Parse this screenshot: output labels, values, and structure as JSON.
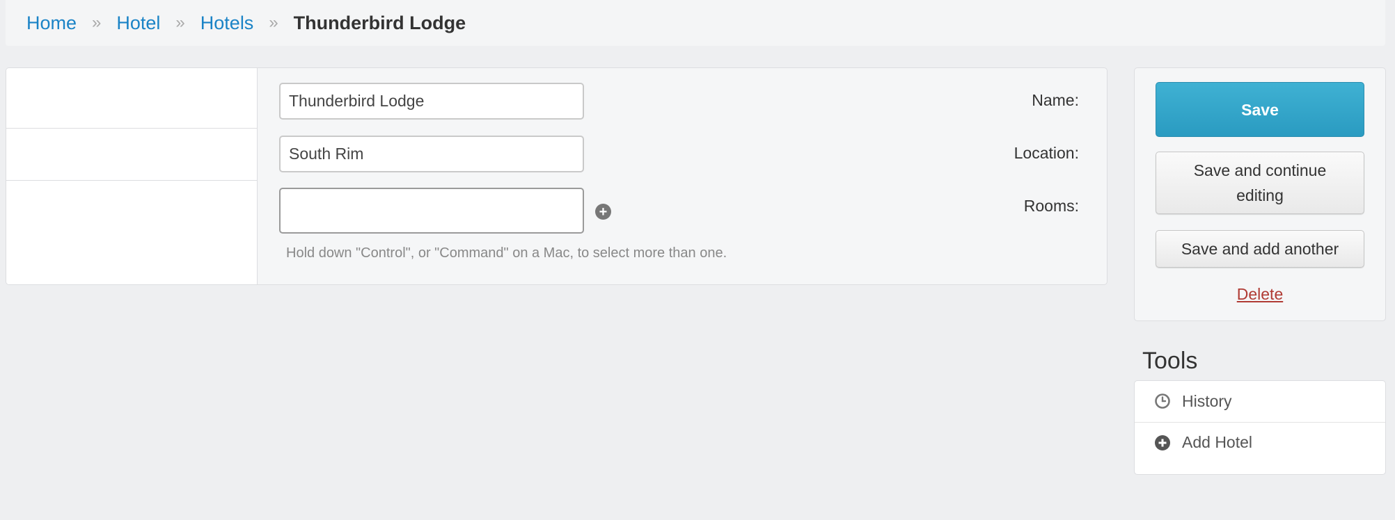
{
  "breadcrumb": {
    "items": [
      {
        "label": "Home"
      },
      {
        "label": "Hotel"
      },
      {
        "label": "Hotels"
      }
    ],
    "separator": "»",
    "current": "Thunderbird Lodge"
  },
  "form": {
    "name": {
      "label": "Name:",
      "value": "Thunderbird Lodge"
    },
    "location": {
      "label": "Location:",
      "value": "South Rim"
    },
    "rooms": {
      "label": "Rooms:",
      "value": "",
      "help": "Hold down \"Control\", or \"Command\" on a Mac, to select more than one."
    }
  },
  "submit": {
    "save": "Save",
    "save_continue": "Save and continue editing",
    "save_add": "Save and add another",
    "delete": "Delete"
  },
  "tools": {
    "title": "Tools",
    "items": [
      {
        "label": "History",
        "icon": "clock-icon"
      },
      {
        "label": "Add Hotel",
        "icon": "plus-circle-icon"
      }
    ]
  },
  "colors": {
    "link": "#1a83c6",
    "primary_button": "#2a9bc1",
    "delete": "#b03b34",
    "background": "#eeeff1"
  }
}
